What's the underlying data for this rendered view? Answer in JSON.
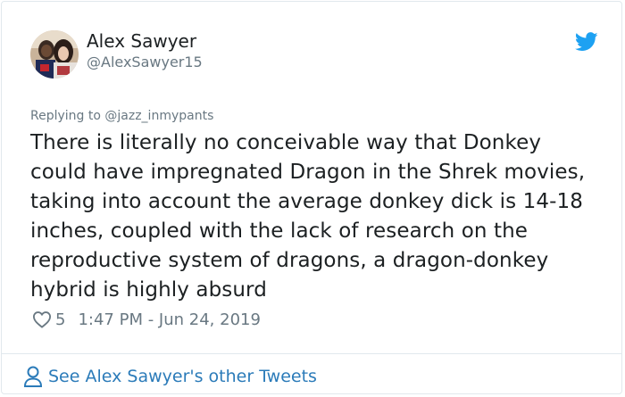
{
  "author": {
    "name": "Alex Sawyer",
    "handle": "@AlexSawyer15"
  },
  "reply": {
    "prefix": "Replying to",
    "handle": "@jazz_inmypants"
  },
  "tweet": {
    "text": "There is literally no conceivable way that Donkey could have impregnated Dragon in the Shrek movies, taking into account the average donkey dick is 14-18 inches, coupled with the lack of research on the reproductive system of dragons, a dragon-donkey hybrid is highly absurd"
  },
  "meta": {
    "likes": "5",
    "timestamp": "1:47 PM - Jun 24, 2019"
  },
  "footer": {
    "label": "See Alex Sawyer's other Tweets"
  },
  "colors": {
    "brand": "#1da1f2",
    "link": "#2b7bb9",
    "muted": "#697882",
    "text": "#1c2022"
  },
  "icons": {
    "logo": "twitter-bird-icon",
    "like": "heart-icon",
    "profile": "person-icon"
  }
}
